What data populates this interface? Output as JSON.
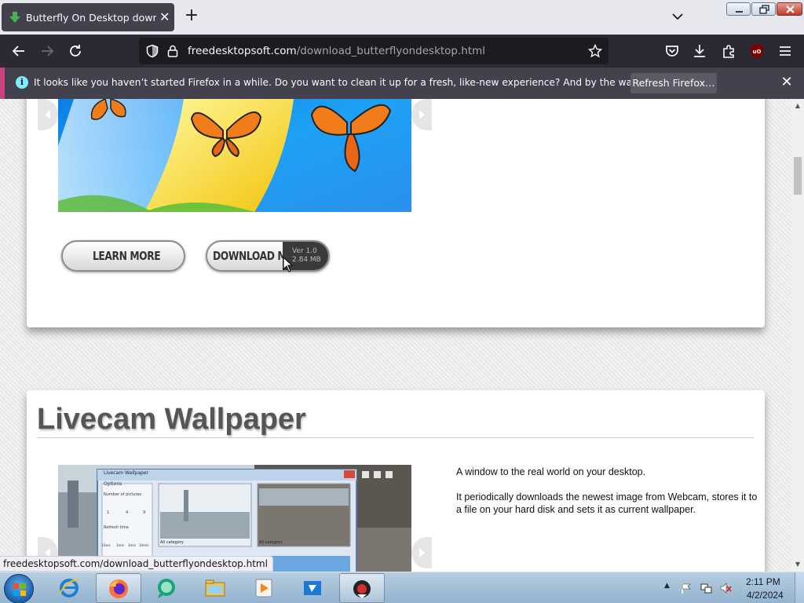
{
  "browser": {
    "tab": {
      "title": "Butterfly On Desktop download",
      "close": "✕"
    },
    "new_tab": "+",
    "url": {
      "host": "freedesktopsoft.com",
      "path": "/download_butterflyondesktop.html"
    },
    "notification": {
      "text": "It looks like you haven’t started Firefox in a while. Do you want to clean it up for a fresh, like-new experience? And by the way, welcome back!",
      "button": "Refresh Firefox…",
      "close": "✕",
      "info": "i",
      "accent": "#c9417e"
    },
    "status_url": "freedesktopsoft.com/download_butterflyondesktop.html"
  },
  "page": {
    "product1": {
      "learn_more": "LEARN MORE",
      "download": "DOWNLOAD ME!",
      "version": "Ver 1.0",
      "size": "2.84 MB"
    },
    "product2": {
      "title": "Livecam Wallpaper",
      "desc1": "A window to the real world on your desktop.",
      "desc2": "It periodically downloads the newest image from Webcam, stores it to a file on your hard disk and sets it as current wallpaper.",
      "screenshot": {
        "window_title": "Livecam Wallpaper",
        "options": "Options",
        "num_pictures": "Number of pictures",
        "refresh_time": "Refresh time",
        "nums": [
          "1",
          "4",
          "9"
        ],
        "times": [
          "10sec",
          "1min",
          "3min",
          "10min"
        ],
        "all_category": "All category"
      }
    }
  },
  "taskbar": {
    "time": "2:11 PM",
    "date": "4/2/2024",
    "tray_arrow": "▲"
  }
}
